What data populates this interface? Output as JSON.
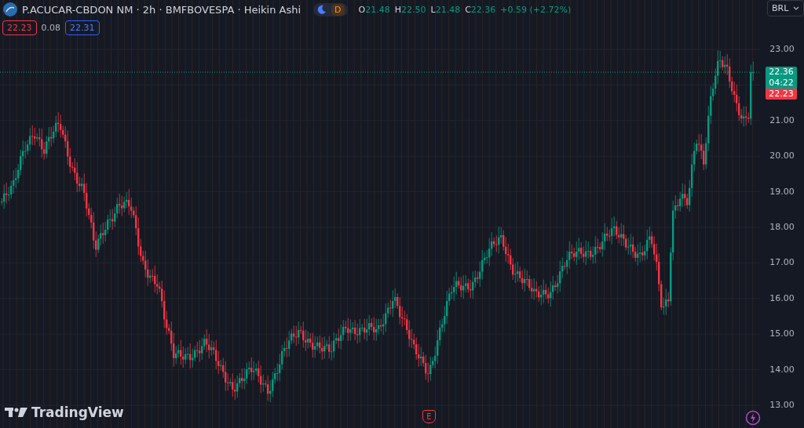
{
  "header": {
    "title": "P.ACUCAR-CBDON NM · 2h · BMFBOVESPA · Heikin Ashi",
    "session_day_label": "D",
    "ohlc": [
      {
        "label": "O",
        "value": "21.48"
      },
      {
        "label": "H",
        "value": "22.50"
      },
      {
        "label": "L",
        "value": "21.48"
      },
      {
        "label": "C",
        "value": "22.36"
      }
    ],
    "change": "+0.59 (+2.72%)"
  },
  "trade": {
    "sell": "22.23",
    "spread": "0.08",
    "buy": "22.31"
  },
  "price_axis": {
    "currency": "BRL",
    "ticks": [
      "23.00",
      "21.00",
      "20.00",
      "19.00",
      "18.00",
      "17.00",
      "16.00",
      "15.00",
      "14.00",
      "13.00"
    ]
  },
  "price_labels": {
    "last": "22.36",
    "countdown": "04:22",
    "bid": "22.23"
  },
  "event_marker": "E",
  "brand": "TradingView"
}
